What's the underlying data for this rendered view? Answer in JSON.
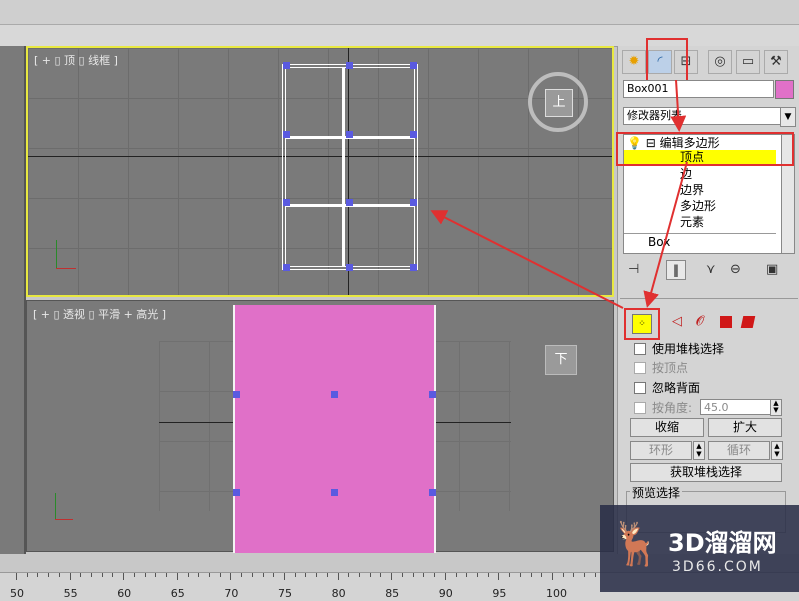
{
  "viewports": {
    "top": {
      "label": "[ + ▯ 顶 ▯ 线框 ]",
      "cube": "上"
    },
    "perspective": {
      "label": "[ + ▯ 透视 ▯ 平滑 + 高光 ]",
      "cube": "下"
    }
  },
  "panel": {
    "tabs": [
      {
        "icon": "sun-icon",
        "glyph": "✹"
      },
      {
        "icon": "modify-icon",
        "glyph": "◜"
      },
      {
        "icon": "hierarchy-icon",
        "glyph": "⊟"
      },
      {
        "icon": "motion-icon",
        "glyph": "◎"
      },
      {
        "icon": "display-icon",
        "glyph": "▭"
      },
      {
        "icon": "utilities-icon",
        "glyph": "⚒"
      }
    ],
    "object_name": "Box001",
    "object_color": "#e070c8",
    "modifier_list": "修改器列表",
    "stack": {
      "root": "编辑多边形",
      "items": [
        "顶点",
        "边",
        "边界",
        "多边形",
        "元素"
      ],
      "selected": "顶点",
      "base": "Box"
    },
    "selection": {
      "use_stack": "使用堆栈选择",
      "by_vertex": "按顶点",
      "ignore_back": "忽略背面",
      "by_angle": "按角度:",
      "angle_value": "45.0",
      "shrink": "收缩",
      "grow": "扩大",
      "ring": "环形",
      "loop": "循环",
      "get_stack": "获取堆栈选择",
      "preview": "预览选择"
    }
  },
  "ruler": {
    "labels": [
      "50",
      "55",
      "60",
      "65",
      "70",
      "75",
      "80",
      "85",
      "90",
      "95",
      "100"
    ]
  },
  "watermark": {
    "title": "3D溜溜网",
    "url": "3D66.COM"
  },
  "colors": {
    "highlight": "#ffff00",
    "accent_red": "#e03030",
    "vertex": "#5a5ae0",
    "box_pink": "#e070c8"
  }
}
